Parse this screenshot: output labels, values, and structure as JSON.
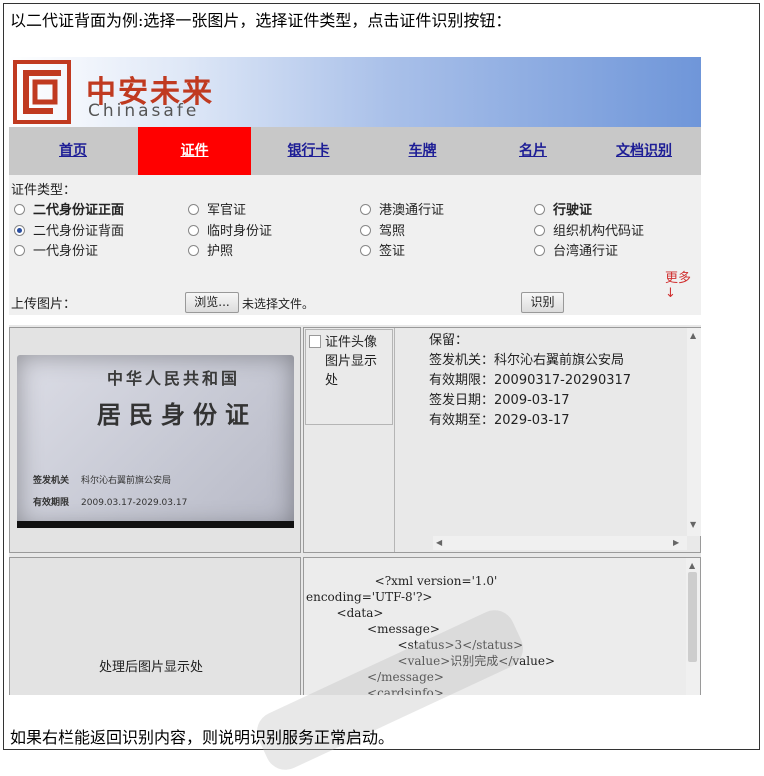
{
  "doc": {
    "intro": "以二代证背面为例:选择一张图片，选择证件类型，点击证件识别按钮：",
    "outro": "如果右栏能返回识别内容，则说明识别服务正常启动。"
  },
  "brand": {
    "cn": "中安未来",
    "en": "Chinasafe",
    "color": "#c03a20"
  },
  "nav": {
    "items": [
      {
        "label": "首页",
        "active": false
      },
      {
        "label": "证件",
        "active": true
      },
      {
        "label": "银行卡",
        "active": false
      },
      {
        "label": "车牌",
        "active": false
      },
      {
        "label": "名片",
        "active": false
      },
      {
        "label": "文档识别",
        "active": false
      }
    ],
    "active_color": "#ff0000",
    "link_color": "#1e1e96"
  },
  "form": {
    "cert_type_label": "证件类型：",
    "options": [
      {
        "label": "二代身份证正面",
        "checked": false,
        "bold": true
      },
      {
        "label": "二代身份证背面",
        "checked": true,
        "bold": false
      },
      {
        "label": "一代身份证",
        "checked": false,
        "bold": false
      },
      {
        "label": "军官证",
        "checked": false,
        "bold": false
      },
      {
        "label": "临时身份证",
        "checked": false,
        "bold": false
      },
      {
        "label": "护照",
        "checked": false,
        "bold": false
      },
      {
        "label": "港澳通行证",
        "checked": false,
        "bold": false
      },
      {
        "label": "驾照",
        "checked": false,
        "bold": false
      },
      {
        "label": "签证",
        "checked": false,
        "bold": false
      },
      {
        "label": "行驶证",
        "checked": false,
        "bold": true
      },
      {
        "label": "组织机构代码证",
        "checked": false,
        "bold": false
      },
      {
        "label": "台湾通行证",
        "checked": false,
        "bold": false
      }
    ],
    "more_label": "更多↓",
    "upload_label": "上传图片：",
    "browse_button": "浏览...",
    "no_file_text": "未选择文件。",
    "recognize_button": "识别"
  },
  "id_card": {
    "title_line1": "中华人民共和国",
    "title_line2": "居民身份证",
    "authority_key": "签发机关",
    "authority_value": "科尔沁右翼前旗公安局",
    "validity_key": "有效期限",
    "validity_value": "2009.03.17-2029.03.17"
  },
  "head_placeholder": "证件头像图片显示处",
  "result": {
    "lines": [
      "保留：",
      "签发机关：科尔沁右翼前旗公安局",
      "有效期限：20090317-20290317",
      "签发日期：2009-03-17",
      "有效期至：2029-03-17"
    ]
  },
  "processed_placeholder": "处理后图片显示处",
  "xml_text": "                  <?xml version='1.0'\nencoding='UTF-8'?>\n        <data>\n                <message>\n                        <status>3</status>\n                        <value>识别完成</value>\n                </message>\n                <cardsinfo>"
}
